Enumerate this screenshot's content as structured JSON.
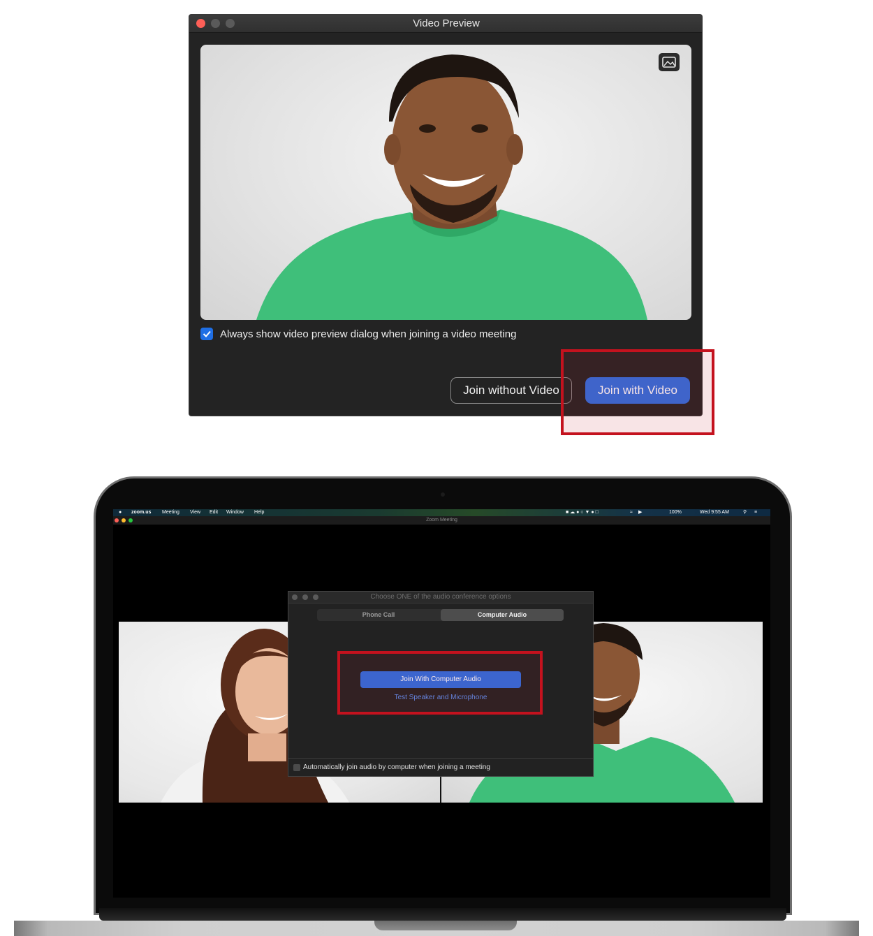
{
  "video_preview": {
    "title": "Video Preview",
    "checkbox_label": "Always show video preview dialog when joining a video meeting",
    "checkbox_checked": true,
    "join_without_video": "Join without Video",
    "join_with_video": "Join with Video",
    "background_icon": "image-background-icon"
  },
  "menubar": {
    "app": "zoom.us",
    "items": [
      "Meeting",
      "View",
      "Edit",
      "Window",
      "Help"
    ],
    "battery": "100%",
    "clock": "Wed 9:55 AM"
  },
  "zoom_window": {
    "title": "Zoom Meeting"
  },
  "audio_dialog": {
    "title": "Choose ONE of the audio conference options",
    "tabs": [
      "Phone Call",
      "Computer Audio"
    ],
    "active_tab": "Computer Audio",
    "join_button": "Join With Computer Audio",
    "test_link": "Test Speaker and Microphone",
    "auto_join_label": "Automatically join audio by computer when joining a meeting",
    "auto_join_checked": false
  },
  "colors": {
    "accent_blue": "#2d6ee0",
    "highlight_red": "#c4121e",
    "shirt_green": "#3fbf7a"
  }
}
